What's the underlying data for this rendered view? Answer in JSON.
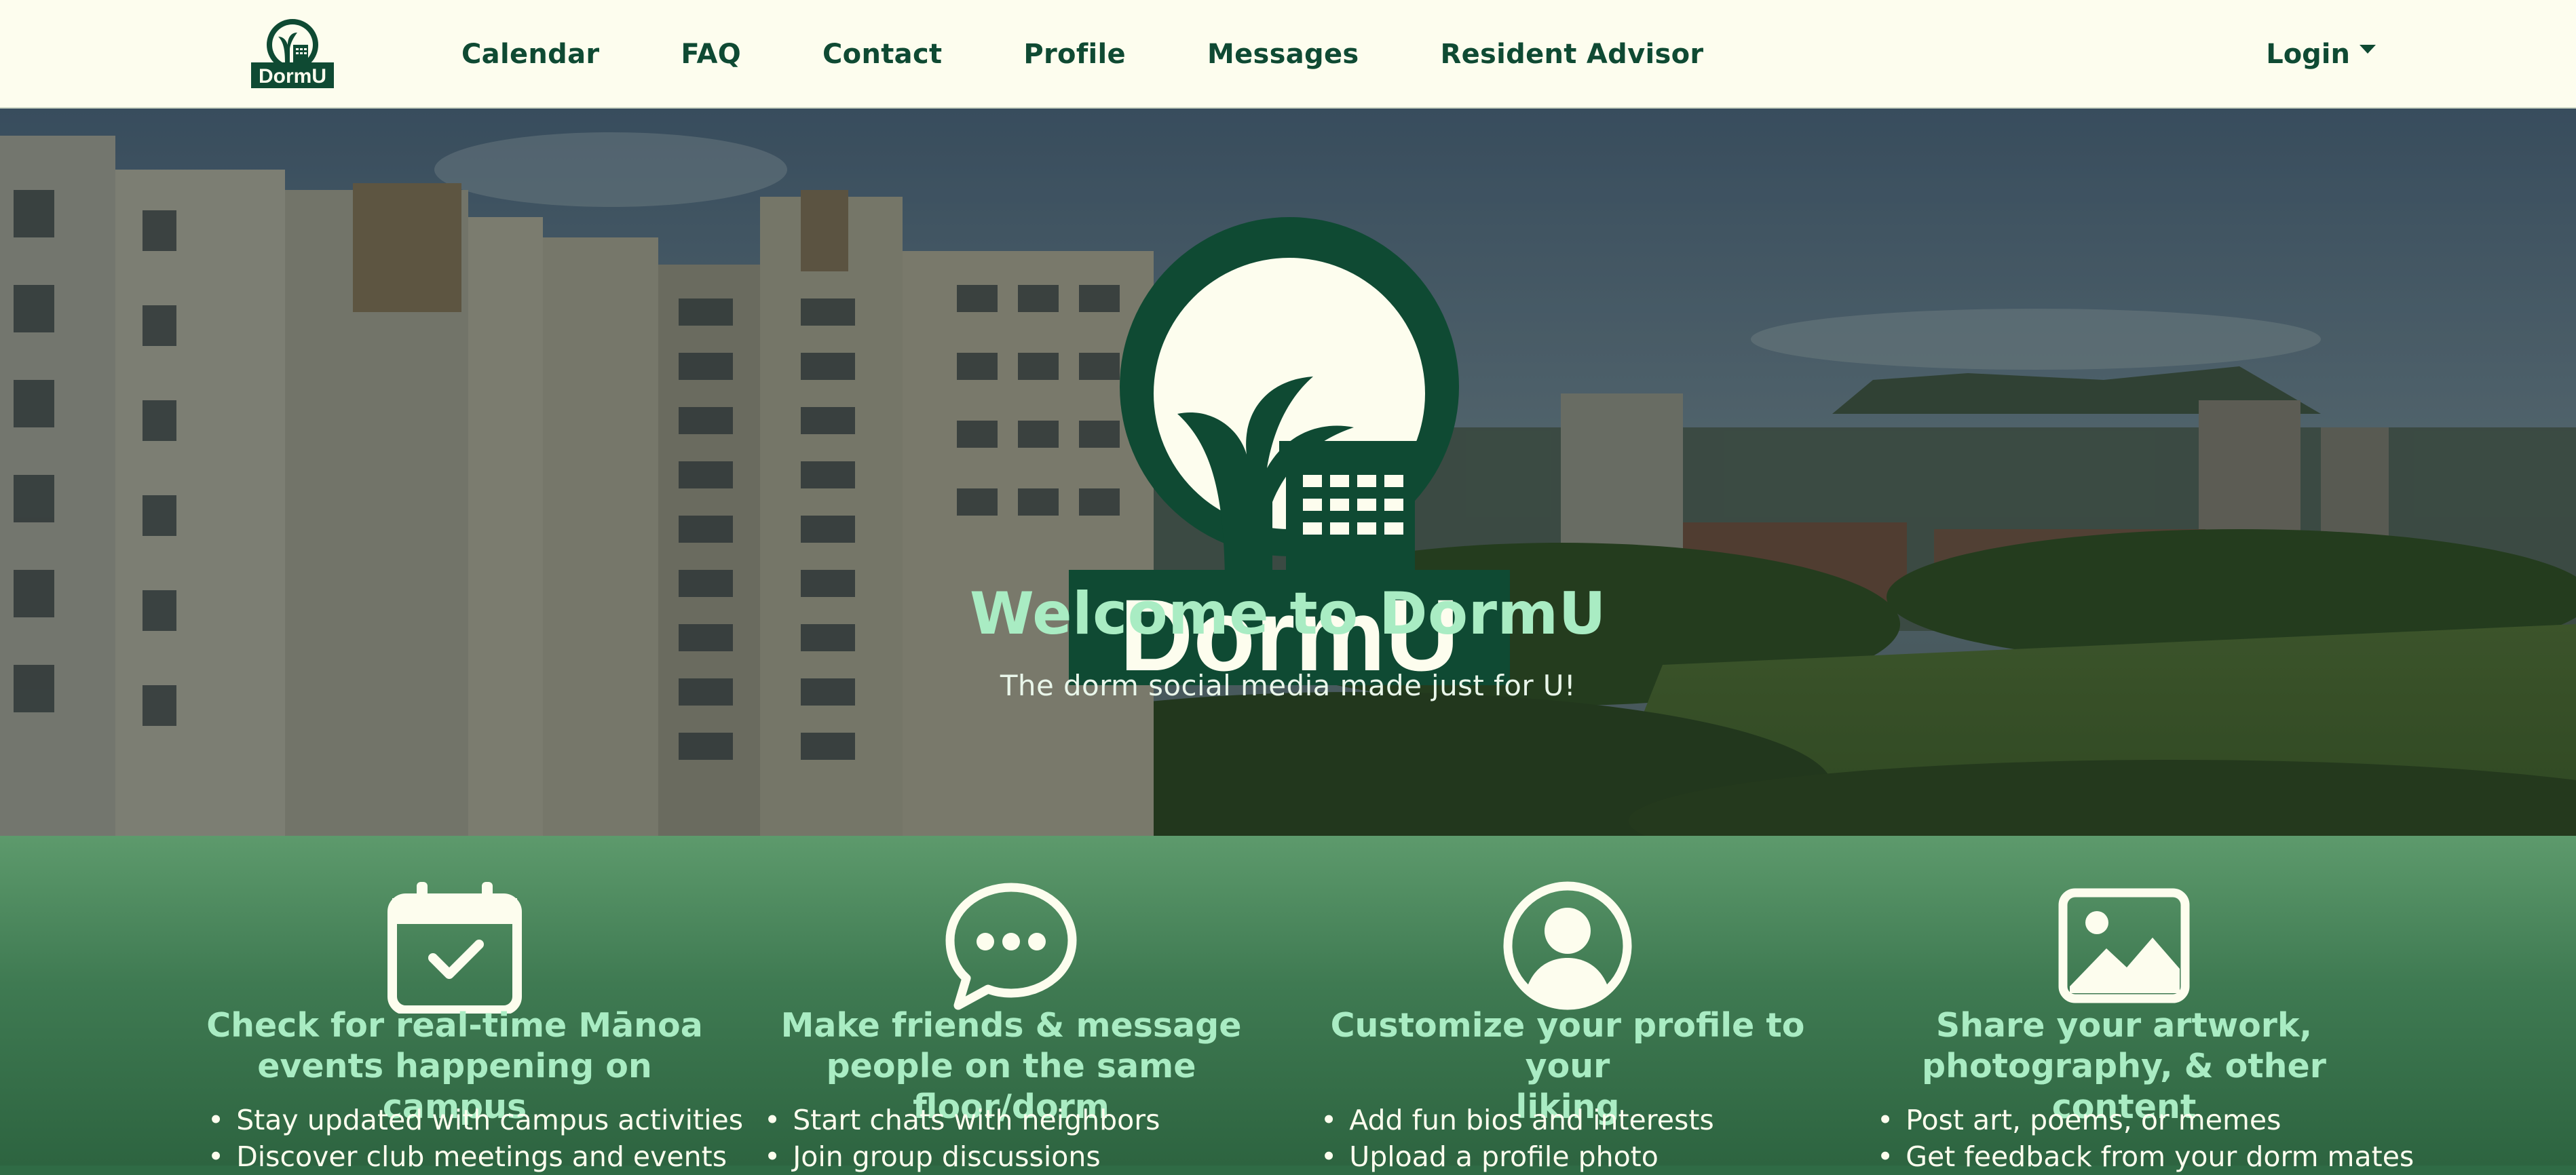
{
  "navbar": {
    "logo_alt": "DormU",
    "links": [
      "Calendar",
      "FAQ",
      "Contact",
      "Profile",
      "Messages",
      "Resident Advisor"
    ],
    "login_label": "Login"
  },
  "hero": {
    "logo_text": "DormU",
    "title": "Welcome to DormU",
    "subtitle": "The dorm social media made just for U!"
  },
  "features": [
    {
      "icon": "calendar-check-icon",
      "title_line1": "Check for real-time Mānoa",
      "title_line2": "events happening on campus",
      "items": [
        "Stay updated with campus activities",
        "Discover club meetings and events"
      ]
    },
    {
      "icon": "chat-bubble-icon",
      "title_line1": "Make friends & message",
      "title_line2": "people on the same floor/dorm",
      "items": [
        "Start chats with neighbors",
        "Join group discussions"
      ]
    },
    {
      "icon": "user-circle-icon",
      "title_line1": "Customize your profile to your",
      "title_line2": "liking",
      "items": [
        "Add fun bios and interests",
        "Upload a profile photo"
      ]
    },
    {
      "icon": "image-icon",
      "title_line1": "Share your artwork,",
      "title_line2": "photography, & other content",
      "items": [
        "Post art, poems, or memes",
        "Get feedback from your dorm mates"
      ]
    }
  ],
  "colors": {
    "brand_dark_green": "#0f4a33",
    "nav_background": "#fdfdee",
    "accent_mint": "#a9ecc3",
    "feature_band": "#3f7a52"
  }
}
